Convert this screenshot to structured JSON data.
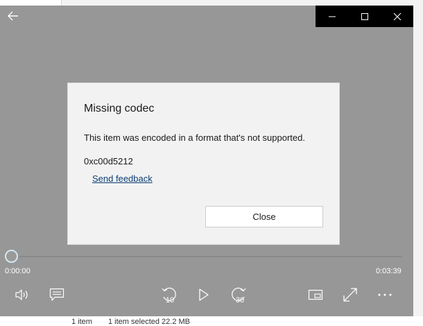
{
  "background_window": {
    "status_items_count": "1 item",
    "status_selected": "1 item selected  22.2 MB"
  },
  "player": {
    "background_color": "#979797",
    "caption_bar_color": "#000000",
    "back_icon": "arrow-left-icon",
    "caption_buttons": [
      "minimize-icon",
      "maximize-icon",
      "close-icon"
    ]
  },
  "dialog": {
    "title": "Missing codec",
    "message": "This item was encoded in a format that's not supported.",
    "error_code": "0xc00d5212",
    "feedback_link": "Send feedback",
    "close_label": "Close",
    "link_color": "#0b3f74"
  },
  "seekbar": {
    "current_time": "0:00:00",
    "total_time": "0:03:39",
    "progress": 0
  },
  "controls": {
    "left": [
      "volume-icon",
      "captions-icon"
    ],
    "center": [
      "skip-back-10-icon",
      "play-icon",
      "skip-forward-30-icon"
    ],
    "right": [
      "mini-view-icon",
      "fullscreen-icon",
      "more-icon"
    ],
    "skip_back_label": "10",
    "skip_forward_label": "30"
  }
}
